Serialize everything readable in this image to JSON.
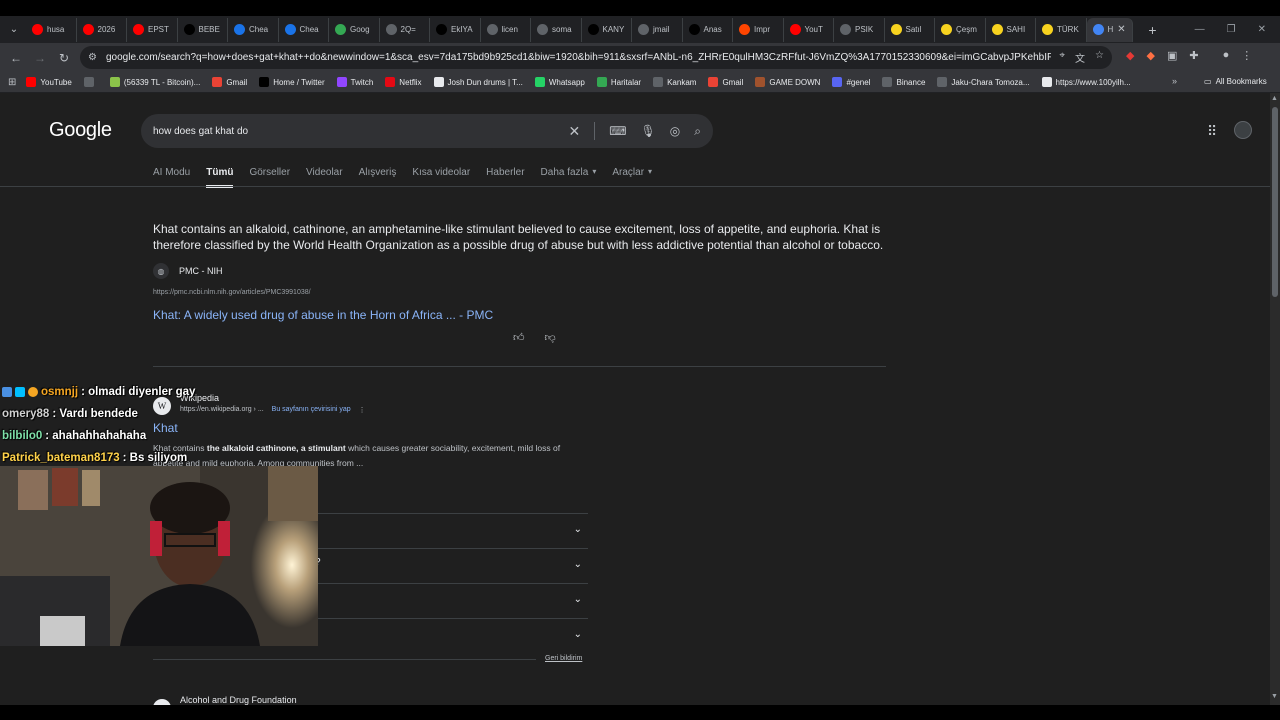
{
  "tabs": [
    {
      "label": "husa",
      "color": "#ff0000",
      "icon": "youtube-icon"
    },
    {
      "label": "2026",
      "color": "#ff0000",
      "icon": "youtube-icon"
    },
    {
      "label": "EPST",
      "color": "#ff0000",
      "icon": "youtube-icon"
    },
    {
      "label": "BEBE",
      "color": "#000000",
      "icon": "x-icon"
    },
    {
      "label": "Chea",
      "color": "#1a73e8",
      "icon": "page-icon"
    },
    {
      "label": "Chea",
      "color": "#1a73e8",
      "icon": "page-icon"
    },
    {
      "label": "Goog",
      "color": "#34a853",
      "icon": "maps-icon"
    },
    {
      "label": "2Q=",
      "color": "#5f6368",
      "icon": "link-icon"
    },
    {
      "label": "EkIYA",
      "color": "#000000",
      "icon": "x-icon"
    },
    {
      "label": "licen",
      "color": "#5f6368",
      "icon": "link-icon"
    },
    {
      "label": "soma",
      "color": "#5f6368",
      "icon": "globe-icon"
    },
    {
      "label": "KANY",
      "color": "#000000",
      "icon": "x-icon"
    },
    {
      "label": "jmail",
      "color": "#5f6368",
      "icon": "globe-icon"
    },
    {
      "label": "Anas",
      "color": "#000000",
      "icon": "x-icon"
    },
    {
      "label": "Impr",
      "color": "#ff4500",
      "icon": "reddit-icon"
    },
    {
      "label": "YouT",
      "color": "#ff0000",
      "icon": "youtube-icon"
    },
    {
      "label": "PSIK",
      "color": "#5f6368",
      "icon": "globe-icon"
    },
    {
      "label": "Satıl",
      "color": "#f7d21f",
      "icon": "s-icon"
    },
    {
      "label": "Çeşm",
      "color": "#f7d21f",
      "icon": "s-icon"
    },
    {
      "label": "SAHI",
      "color": "#f7d21f",
      "icon": "s-icon"
    },
    {
      "label": "TÜRK",
      "color": "#f7d21f",
      "icon": "s-icon"
    },
    {
      "label": "H",
      "color": "#4285f4",
      "icon": "google-icon",
      "active": true
    }
  ],
  "toolbar": {
    "url": "google.com/search?q=how+does+gat+khat++do&newwindow=1&sca_esv=7da175bd9b925cd1&biw=1920&bih=911&sxsrf=ANbL-n6_ZHRrE0qulHM3CzRFfut-J6VmZQ%3A1770152330609&ei=imGCabvpJPKehbIPw5b..."
  },
  "bookmarks": [
    {
      "label": "YouTube",
      "color": "#ff0000"
    },
    {
      "label": "",
      "color": "#5f6368"
    },
    {
      "label": "(56339 TL - Bitcoin)...",
      "color": "#8bc34a"
    },
    {
      "label": "Gmail",
      "color": "#ea4335"
    },
    {
      "label": "Home / Twitter",
      "color": "#000000"
    },
    {
      "label": "Twitch",
      "color": "#9146ff"
    },
    {
      "label": "Netflix",
      "color": "#e50914"
    },
    {
      "label": "Josh Dun drums | T...",
      "color": "#e8eaed"
    },
    {
      "label": "Whatsapp",
      "color": "#25d366"
    },
    {
      "label": "Haritalar",
      "color": "#34a853"
    },
    {
      "label": "Kankam",
      "color": "#5f6368"
    },
    {
      "label": "Gmail",
      "color": "#ea4335"
    },
    {
      "label": "GAME DOWN",
      "color": "#a0522d"
    },
    {
      "label": "#genel",
      "color": "#5865f2"
    },
    {
      "label": "Binance",
      "color": "#5f6368"
    },
    {
      "label": "Jaku-Chara Tomoza...",
      "color": "#5f6368"
    },
    {
      "label": "https://www.100yilh...",
      "color": "#e8eaed"
    }
  ],
  "bookmarks_all": "All Bookmarks",
  "google": {
    "logo": "Google",
    "query": "how does gat khat do",
    "tabs": [
      "AI Modu",
      "Tümü",
      "Görseller",
      "Videolar",
      "Alışveriş",
      "Kısa videolar",
      "Haberler",
      "Daha fazla",
      "Araçlar"
    ],
    "active_tab": "Tümü"
  },
  "featured": {
    "text": "Khat contains an alkaloid, cathinone, an amphetamine-like stimulant believed to cause excitement, loss of appetite, and euphoria. Khat is therefore classified by the World Health Organization as a possible drug of abuse but with less addictive potential than alcohol or tobacco.",
    "source_name": "PMC - NIH",
    "source_url": "https://pmc.ncbi.nlm.nih.gov/articles/PMC3991038/",
    "title": "Khat: A widely used drug of abuse in the Horn of Africa ... - PMC"
  },
  "wiki": {
    "site": "Wikipedia",
    "url": "https://en.wikipedia.org › ...",
    "translate": "Bu sayfanın çevirisini yap",
    "title": "Khat",
    "desc_prefix": "Khat contains ",
    "desc_bold1": "the alkaloid cathinone, a stimulant",
    "desc_rest": " which causes greater sociability, excitement, mild loss of appetite and mild euphoria. Among communities from ..."
  },
  "paa_partial": "?",
  "feedback_link": "Geri bildirim",
  "next_result": "Alcohol and Drug Foundation",
  "chat": [
    {
      "user": "osmnjj",
      "color": "#f5a623",
      "msg": ": olmadi diyenler gay"
    },
    {
      "user": "omery88",
      "color": "#d0d0d0",
      "msg": ": Vardı bendede"
    },
    {
      "user": "bilbilo0",
      "color": "#7ee0a8",
      "msg": ": ahahahhahahaha"
    },
    {
      "user": "Patrick_bateman8173",
      "color": "#ffd24a",
      "msg": ": Bs siliyom"
    }
  ]
}
